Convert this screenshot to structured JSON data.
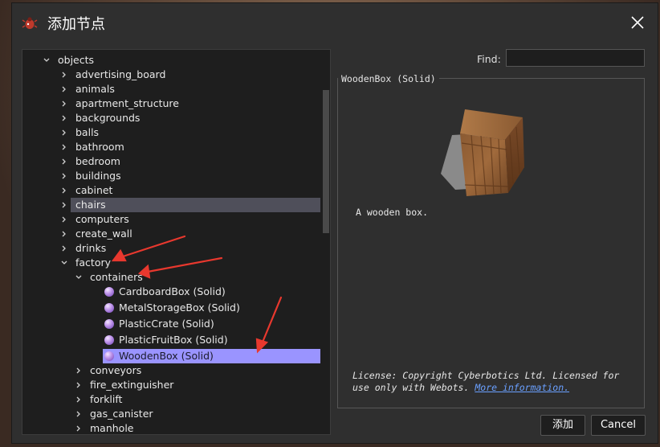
{
  "window": {
    "title": "添加节点"
  },
  "tree": {
    "items": [
      {
        "label": "objects",
        "level": 0,
        "expanded": true,
        "kind": "folder"
      },
      {
        "label": "advertising_board",
        "level": 1,
        "expanded": false,
        "kind": "folder"
      },
      {
        "label": "animals",
        "level": 1,
        "expanded": false,
        "kind": "folder"
      },
      {
        "label": "apartment_structure",
        "level": 1,
        "expanded": false,
        "kind": "folder"
      },
      {
        "label": "backgrounds",
        "level": 1,
        "expanded": false,
        "kind": "folder"
      },
      {
        "label": "balls",
        "level": 1,
        "expanded": false,
        "kind": "folder"
      },
      {
        "label": "bathroom",
        "level": 1,
        "expanded": false,
        "kind": "folder"
      },
      {
        "label": "bedroom",
        "level": 1,
        "expanded": false,
        "kind": "folder"
      },
      {
        "label": "buildings",
        "level": 1,
        "expanded": false,
        "kind": "folder"
      },
      {
        "label": "cabinet",
        "level": 1,
        "expanded": false,
        "kind": "folder"
      },
      {
        "label": "chairs",
        "level": 1,
        "expanded": false,
        "kind": "folder",
        "highlight": "gray"
      },
      {
        "label": "computers",
        "level": 1,
        "expanded": false,
        "kind": "folder"
      },
      {
        "label": "create_wall",
        "level": 1,
        "expanded": false,
        "kind": "folder"
      },
      {
        "label": "drinks",
        "level": 1,
        "expanded": false,
        "kind": "folder"
      },
      {
        "label": "factory",
        "level": 1,
        "expanded": true,
        "kind": "folder"
      },
      {
        "label": "containers",
        "level": 2,
        "expanded": true,
        "kind": "folder"
      },
      {
        "label": "CardboardBox (Solid)",
        "level": 3,
        "kind": "node"
      },
      {
        "label": "MetalStorageBox (Solid)",
        "level": 3,
        "kind": "node"
      },
      {
        "label": "PlasticCrate (Solid)",
        "level": 3,
        "kind": "node"
      },
      {
        "label": "PlasticFruitBox (Solid)",
        "level": 3,
        "kind": "node"
      },
      {
        "label": "WoodenBox (Solid)",
        "level": 3,
        "kind": "node",
        "highlight": "purple"
      },
      {
        "label": "conveyors",
        "level": 2,
        "expanded": false,
        "kind": "folder"
      },
      {
        "label": "fire_extinguisher",
        "level": 2,
        "expanded": false,
        "kind": "folder"
      },
      {
        "label": "forklift",
        "level": 2,
        "expanded": false,
        "kind": "folder"
      },
      {
        "label": "gas_canister",
        "level": 2,
        "expanded": false,
        "kind": "folder"
      },
      {
        "label": "manhole",
        "level": 2,
        "expanded": false,
        "kind": "folder"
      }
    ]
  },
  "find": {
    "label": "Find:",
    "value": ""
  },
  "info": {
    "group_title": "WoodenBox (Solid)",
    "description": "A wooden box.",
    "license_text": "License: Copyright Cyberbotics Ltd. Licensed for use only with Webots.",
    "license_link": "More information."
  },
  "buttons": {
    "add": "添加",
    "cancel": "Cancel"
  },
  "colors": {
    "dialog_bg": "#2f2f2f",
    "tree_bg": "#1e1e1e",
    "selection_purple": "#9a94ff",
    "selection_gray": "#4f4f5a",
    "link": "#6aa0ff",
    "annotation_arrow": "#e8382e"
  },
  "icons": {
    "app": "webots-bug-icon",
    "close": "close-icon",
    "expand": "chevron-right-icon",
    "collapse": "chevron-down-icon",
    "node": "purple-ball-icon"
  }
}
